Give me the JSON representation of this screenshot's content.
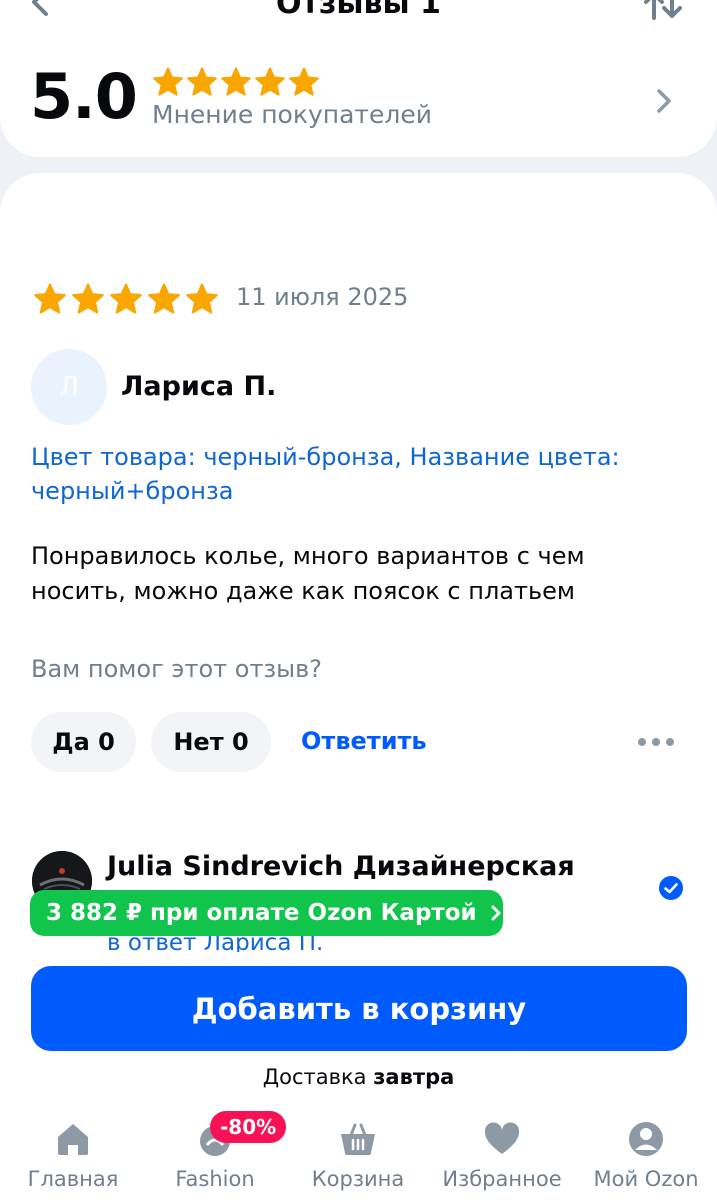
{
  "header": {
    "title": "Отзывы 1"
  },
  "summary": {
    "rating": "5.0",
    "stars": 5,
    "caption": "Мнение покупателей"
  },
  "review": {
    "stars": 5,
    "date": "11 июля 2025",
    "avatar_letter": "Л",
    "author": "Лариса П.",
    "variant": "Цвет товара: черный-бронза, Название цвета: черный+бронза",
    "text": "Понравилось колье, много вариантов с чем носить, можно даже как поясок с платьем",
    "helpful_question": "Вам помог этот отзыв?",
    "yes_label": "Да 0",
    "no_label": "Нет 0",
    "reply_label": "Ответить"
  },
  "seller_reply": {
    "name": "Julia Sindrevich Дизайнерская",
    "reply_to": "в ответ Лариса П."
  },
  "promo": {
    "text": "3 882 ₽ при оплате Ozon Картой"
  },
  "cart": {
    "button_label": "Добавить в корзину",
    "delivery_prefix": "Доставка",
    "delivery_when": "завтра"
  },
  "nav": {
    "items": [
      {
        "label": "Главная",
        "icon": "home-icon"
      },
      {
        "label": "Fashion",
        "icon": "fashion-icon"
      },
      {
        "label": "Корзина",
        "icon": "basket-icon"
      },
      {
        "label": "Избранное",
        "icon": "heart-icon"
      },
      {
        "label": "Мой Ozon",
        "icon": "profile-icon"
      }
    ],
    "sale_badge": "-80%"
  },
  "colors": {
    "accent": "#005bff",
    "star": "#f9a600",
    "promo_green": "#10c44c",
    "sale_pink": "#f91155",
    "link": "#1066d4"
  }
}
